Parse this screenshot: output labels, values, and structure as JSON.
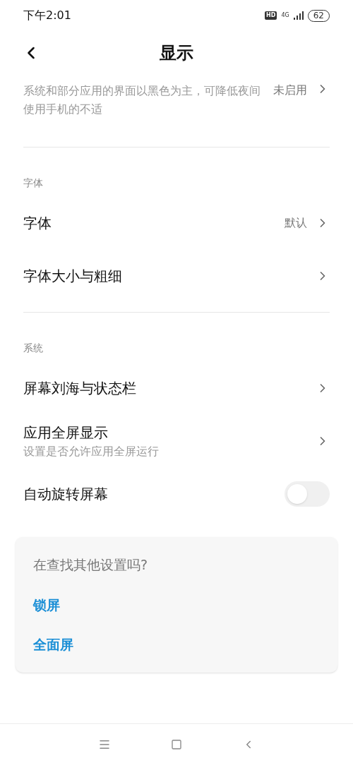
{
  "status_bar": {
    "time": "下午2:01",
    "hd": "HD",
    "network": "4G",
    "battery": "62"
  },
  "header": {
    "title": "显示"
  },
  "top_item": {
    "subtitle": "系统和部分应用的界面以黑色为主，可降低夜间使用手机的不适",
    "value": "未启用"
  },
  "sections": [
    {
      "title": "字体",
      "items": [
        {
          "kind": "link",
          "label": "字体",
          "value": "默认"
        },
        {
          "kind": "link",
          "label": "字体大小与粗细"
        }
      ]
    },
    {
      "title": "系统",
      "items": [
        {
          "kind": "link",
          "label": "屏幕刘海与状态栏"
        },
        {
          "kind": "link",
          "label": "应用全屏显示",
          "subtitle": "设置是否允许应用全屏运行"
        },
        {
          "kind": "toggle",
          "label": "自动旋转屏幕",
          "on": false
        }
      ]
    }
  ],
  "suggest_card": {
    "title": "在查找其他设置吗?",
    "links": [
      "锁屏",
      "全面屏"
    ]
  }
}
